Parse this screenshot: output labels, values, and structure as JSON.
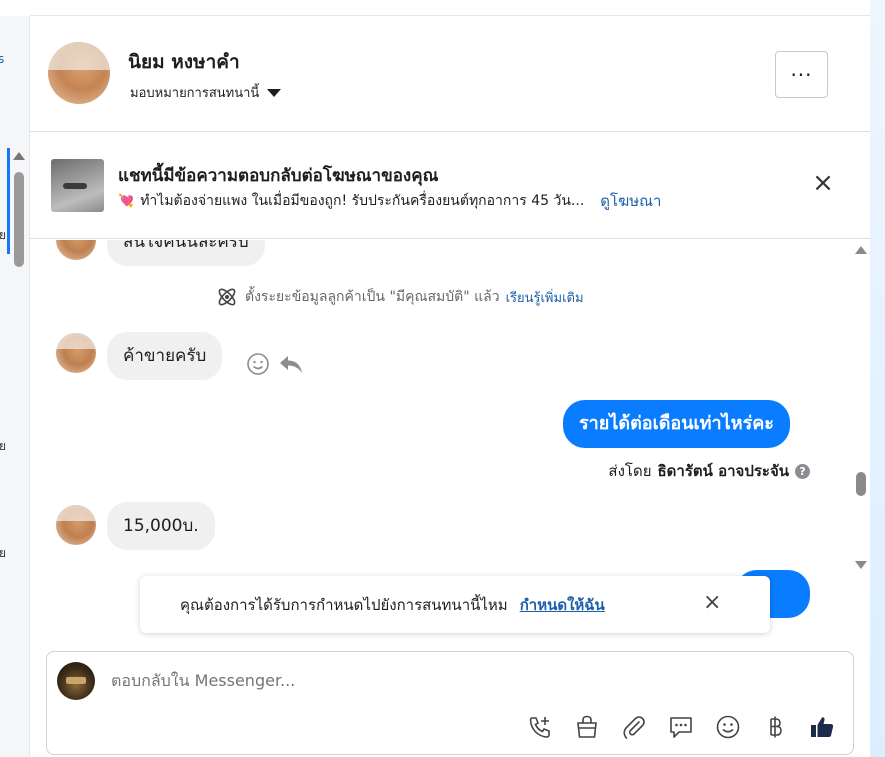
{
  "left_strip": {
    "fragments": [
      "s",
      "ย",
      "ย",
      "ย"
    ]
  },
  "contact": {
    "name": "นิยม หงษาคำ",
    "assign_label": "มอบหมายการสนทนานี้",
    "more_label": "···"
  },
  "ad_banner": {
    "title": "แชทนี้มีข้อความตอบกลับต่อโฆษณาของคุณ",
    "subtitle": "ทำไมต้องจ่ายแพง ในเมื่อมีของถูก! รับประกันครื่องยนต์ทุกอาการ 45 วัน...",
    "link": "ดูโฆษณา",
    "close": "×"
  },
  "messages": {
    "partial_top": "สนใจคนนี้ละครับ",
    "system_note": "ตั้งระยะข้อมูลลูกค้าเป็น \"มีคุณสมบัติ\" แล้ว",
    "system_link": "เรียนรู้เพิ่มเติม",
    "incoming_1": "ค้าขายครับ",
    "outgoing_1": "รายได้ต่อเดือนเท่าไหร่คะ",
    "sent_by_prefix": "ส่งโดย",
    "sent_by_name": "ธิดารัตน์ อาจประจัน",
    "incoming_2": "15,000บ."
  },
  "toast": {
    "text": "คุณต้องการได้รับการกำหนดไปยังการสนทนานี้ไหม",
    "link": "กำหนดให้ฉัน",
    "close": "×"
  },
  "composer": {
    "placeholder": "ตอบกลับใน Messenger...",
    "tools": [
      "add-call-icon",
      "shopping-bag-icon",
      "paperclip-icon",
      "saved-reply-icon",
      "emoji-icon",
      "baht-icon",
      "thumbs-up-icon"
    ]
  },
  "colors": {
    "accent": "#0a7cff",
    "link": "#1d5fa8",
    "bubble_in": "#f0f0f0"
  }
}
